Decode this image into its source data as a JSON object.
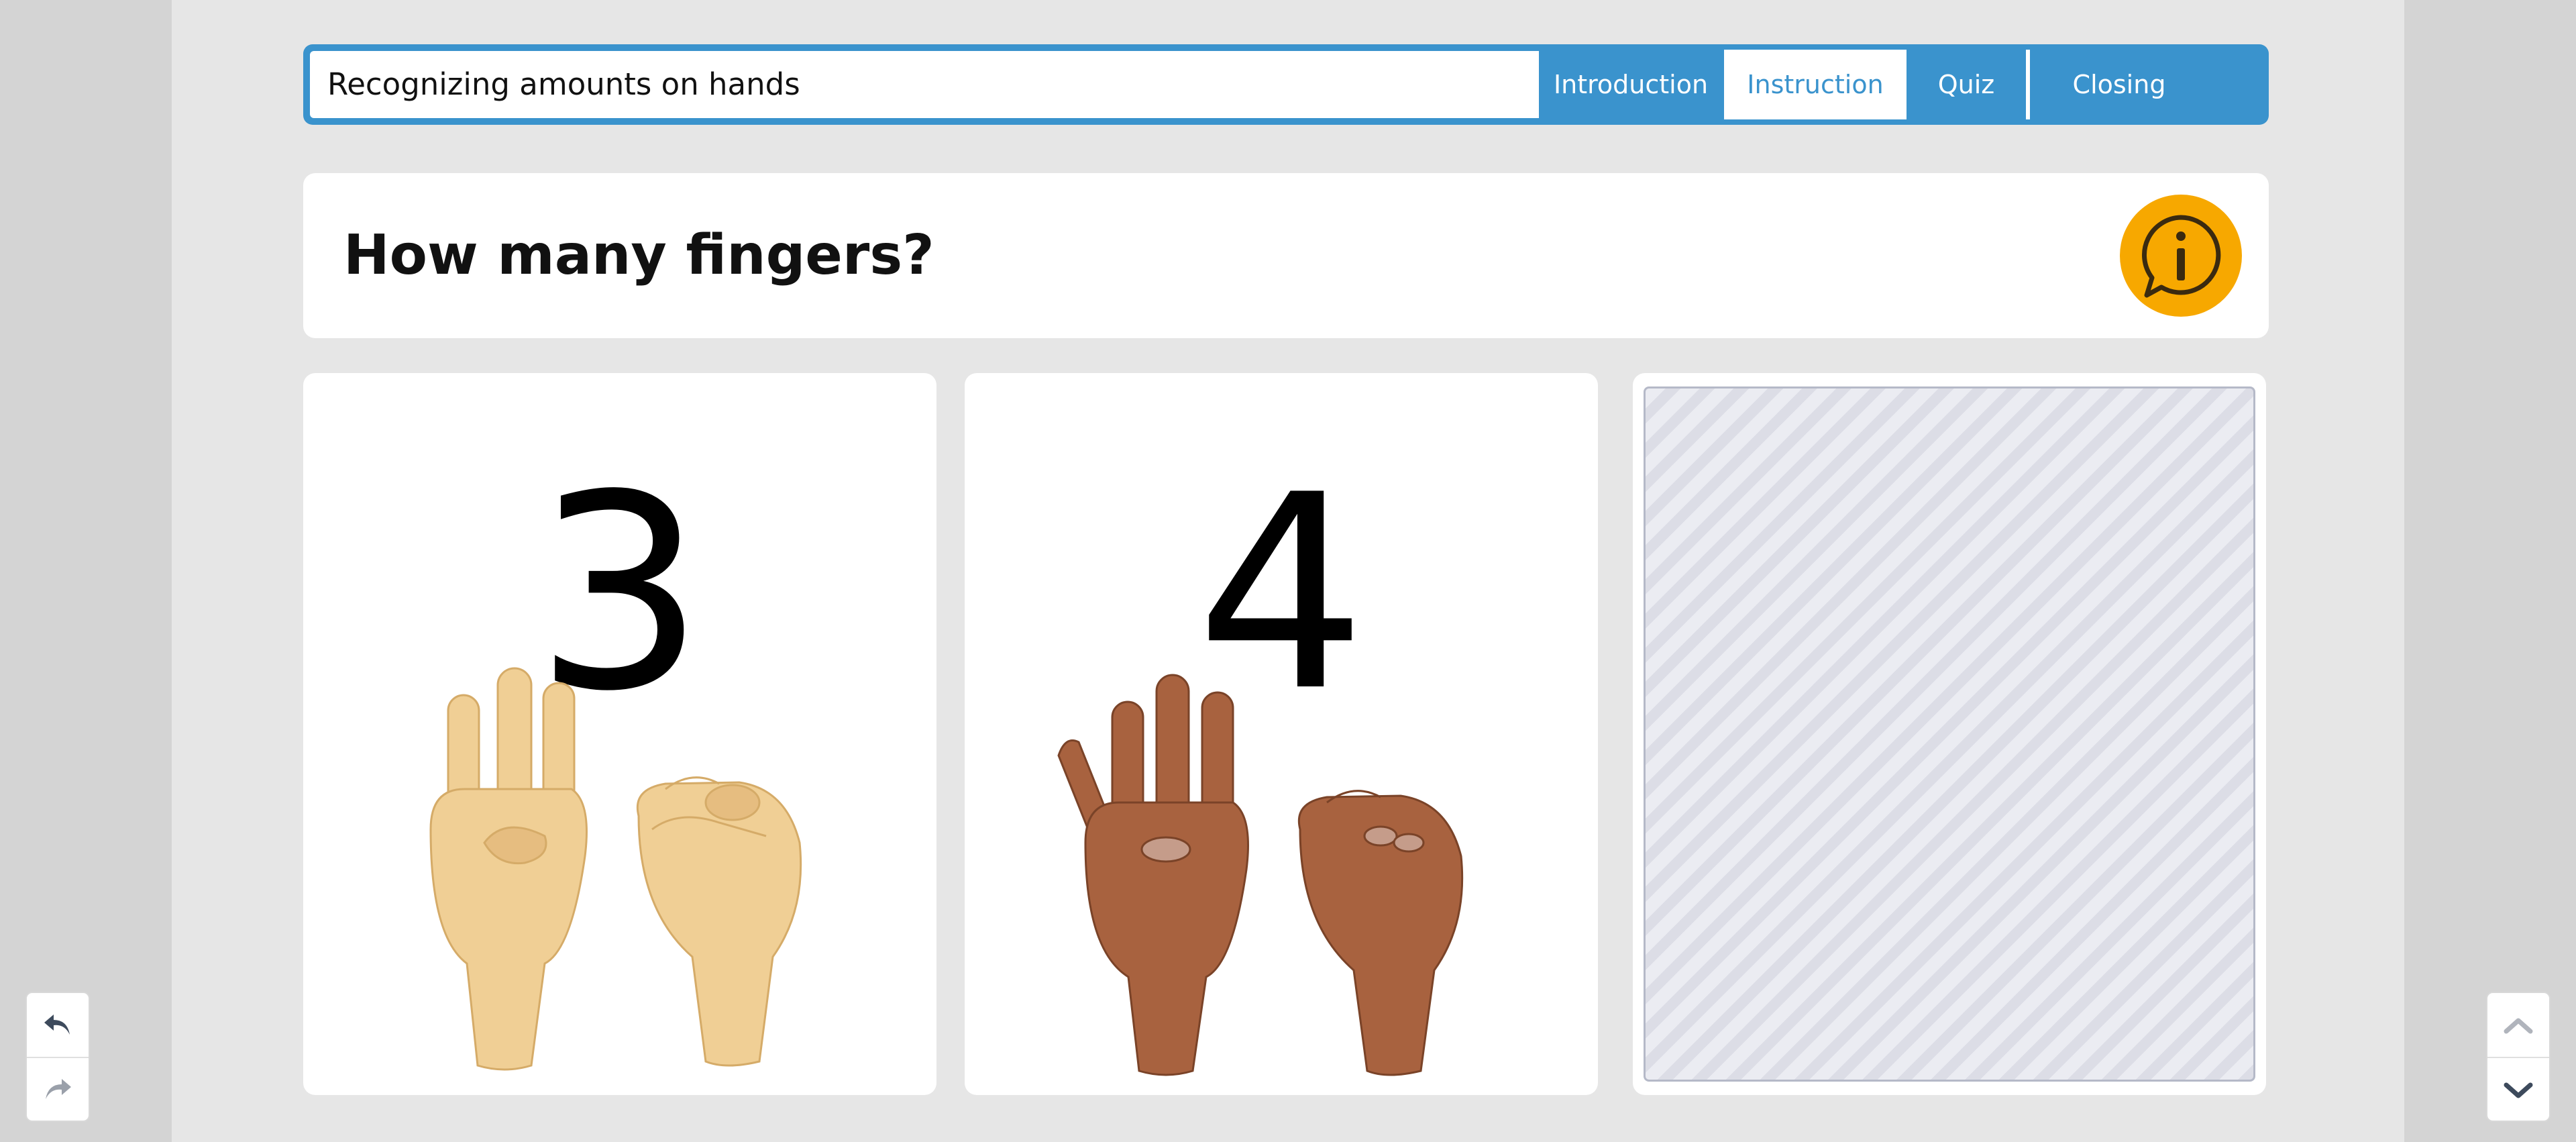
{
  "header": {
    "title": "Recognizing amounts on hands",
    "tabs": [
      {
        "label": "Introduction",
        "active": false
      },
      {
        "label": "Instruction",
        "active": true
      },
      {
        "label": "Quiz",
        "active": false
      },
      {
        "label": "Closing",
        "active": false
      }
    ]
  },
  "question": {
    "text": "How many fingers?",
    "info_icon": "info-speech-bubble-icon"
  },
  "cards": [
    {
      "number": "3",
      "skin": "light",
      "skin_color": "#f0cf95"
    },
    {
      "number": "4",
      "skin": "dark",
      "skin_color": "#a8623f"
    }
  ],
  "dropzone": {
    "pattern": "diagonal-stripes"
  },
  "controls": {
    "left": [
      "undo-icon",
      "redo-icon"
    ],
    "right": [
      "chevron-up-icon",
      "chevron-down-icon"
    ]
  },
  "colors": {
    "accent": "#3a93cd",
    "info": "#f7a800",
    "background": "#e6e6e6"
  }
}
